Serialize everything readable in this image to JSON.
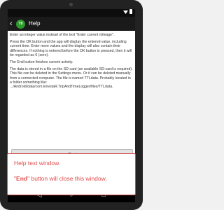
{
  "status_bar": {
    "time": "",
    "icons": [
      "wifi-icon",
      "battery-icon"
    ]
  },
  "app_bar": {
    "title": "Help",
    "logo_text": "Ttl"
  },
  "help_text": {
    "p1": "Enter an integer value instead of the text \"Enter current mileage\".",
    "p2": "Press the OK button and the app will display the entered value, including current time. Enter more values and the display will also contain their differences. If nothing is entered before the OK button is pressed, then it will be regarded as 0 (zero).",
    "p3": "The End button finishes current activity.",
    "p4": "The data is stored in a file on the SD card (an available SD-card is required). This file can be deleted in the Settings menu. Or it can be deleted manually from a connected computer. The file is named TTLdata. Probably located in a folder something like: .../Android/data/com.knivstaR.TripAndTimeLogger/files/TTLdata."
  },
  "end_button": {
    "label": "End"
  },
  "callout": {
    "line1": "Help text window.",
    "line2_prefix": "\"",
    "line2_bold": "End",
    "line2_suffix": "\" button will close this window."
  }
}
